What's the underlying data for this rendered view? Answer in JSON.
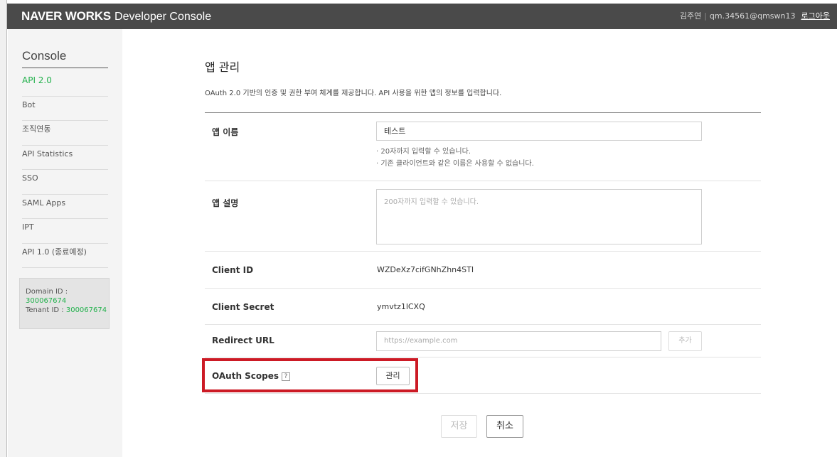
{
  "header": {
    "brand_bold": "NAVER WORKS",
    "brand_sub": "Developer Console",
    "user_name": "김주연",
    "user_email": "qm.34561@qmswn13",
    "logout_label": "로그아웃"
  },
  "sidebar": {
    "title": "Console",
    "items": [
      {
        "label": "API 2.0",
        "active": true
      },
      {
        "label": "Bot"
      },
      {
        "label": "조직연동"
      },
      {
        "label": "API Statistics"
      },
      {
        "label": "SSO"
      },
      {
        "label": "SAML Apps"
      },
      {
        "label": "IPT"
      },
      {
        "label": "API 1.0 (종료예정)"
      }
    ],
    "domain_label": "Domain ID :",
    "domain_value": "300067674",
    "tenant_label": "Tenant ID : ",
    "tenant_value": "300067674"
  },
  "main": {
    "title": "앱 관리",
    "description": "OAuth 2.0 기반의 인증 및 권한 부여 체계를 제공합니다. API 사용을 위한 앱의 정보를 입력합니다.",
    "app_name": {
      "label": "앱 이름",
      "value": "테스트",
      "hint1": "· 20자까지 입력할 수 있습니다.",
      "hint2": "· 기존 클라이언트와 같은 이름은 사용할 수 없습니다."
    },
    "app_desc": {
      "label": "앱 설명",
      "placeholder": "200자까지 입력할 수 있습니다."
    },
    "client_id": {
      "label": "Client ID",
      "value": "WZDeXz7cifGNhZhn4STI"
    },
    "client_secret": {
      "label": "Client Secret",
      "value": "ymvtz1lCXQ"
    },
    "redirect_url": {
      "label": "Redirect URL",
      "placeholder": "https://example.com",
      "add_label": "추가"
    },
    "oauth_scopes": {
      "label": "OAuth Scopes",
      "help": "?",
      "manage_label": "관리"
    },
    "save_label": "저장",
    "cancel_label": "취소"
  },
  "colors": {
    "header_bg": "#4a4a4a",
    "accent_green": "#22b14c",
    "highlight_red": "#cc1a25"
  }
}
